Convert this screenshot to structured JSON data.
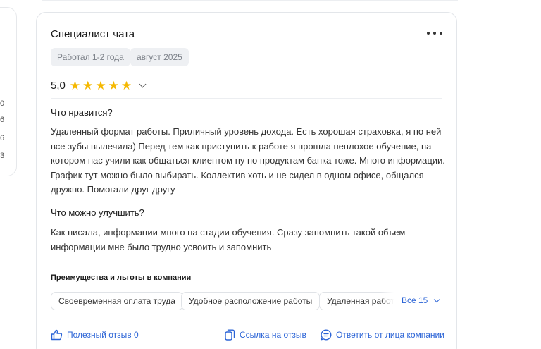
{
  "left_panel": {
    "numbers": [
      "0",
      "6",
      "6",
      "3"
    ]
  },
  "review": {
    "title": "Специалист чата",
    "tags": [
      "Работал 1-2 года",
      "август 2025"
    ],
    "rating": "5,0",
    "stars": 5,
    "likes_title": "Что нравится?",
    "likes_text": "Удаленный формат работы. Приличный уровень дохода. Есть хорошая страховка, я по ней все зубы вылечила) Перед тем как приступить к работе я прошла неплохое обучение, на котором нас учили как общаться клиентом ну по продуктам банка тоже. Много информации. График тут можно было выбирать. Коллектив хоть и не сидел в одном офисе, общался дружно. Помогали друг другу",
    "improve_title": "Что можно улучшить?",
    "improve_text": "Как писала, информации много на стадии обучения. Сразу запомнить такой объем информации мне было трудно усвоить и запомнить",
    "benefits_title": "Преимущества и льготы в компании",
    "benefits": [
      "Своевременная оплата труда",
      "Удобное расположение работы",
      "Удаленная работа"
    ],
    "benefits_all": "Все 15",
    "actions": {
      "helpful": "Полезный отзыв 0",
      "link": "Ссылка на отзыв",
      "reply": "Ответить от лица компании"
    }
  },
  "colors": {
    "accent": "#2a63d6",
    "star": "#f5b800",
    "tag_bg": "#eef0f3"
  }
}
